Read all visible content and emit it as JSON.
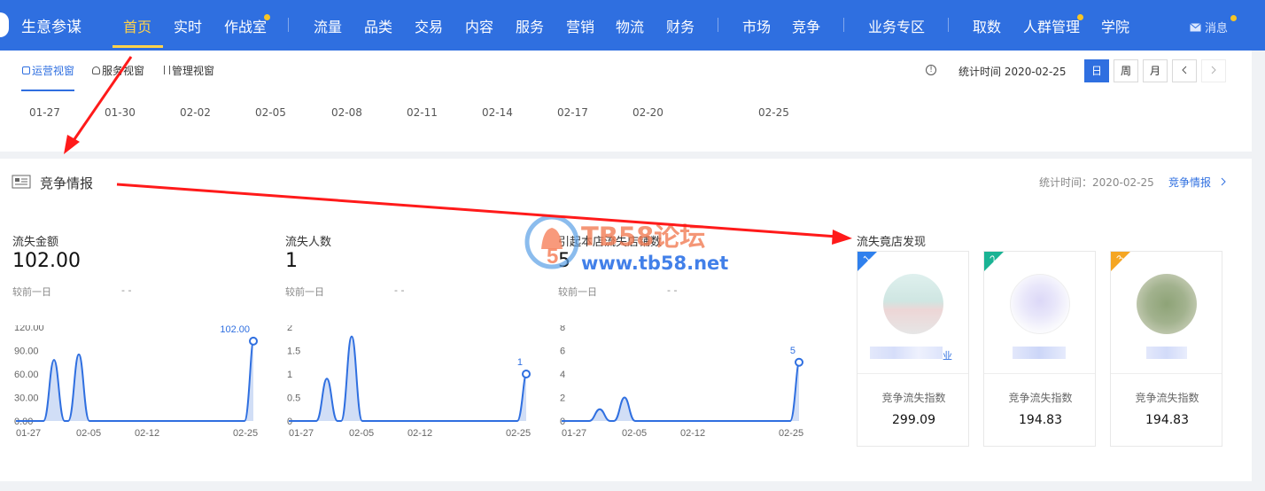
{
  "app": {
    "name": "生意参谋"
  },
  "nav": {
    "items": [
      "首页",
      "实时",
      "作战室",
      "流量",
      "品类",
      "交易",
      "内容",
      "服务",
      "营销",
      "物流",
      "财务",
      "市场",
      "竞争",
      "业务专区",
      "取数",
      "人群管理",
      "学院"
    ],
    "active": "首页",
    "message": "消息"
  },
  "subnav": {
    "tabs": [
      "运营视窗",
      "服务视窗",
      "管理视窗"
    ],
    "stat_label": "统计时间 2020-02-25",
    "periods": [
      "日",
      "周",
      "月"
    ],
    "prev_icon": "chevron-left-icon",
    "next_icon": "chevron-right-icon"
  },
  "date_axis": [
    "01-27",
    "01-30",
    "02-02",
    "02-05",
    "02-08",
    "02-11",
    "02-14",
    "02-17",
    "02-20",
    "02-25"
  ],
  "section": {
    "title": "竞争情报",
    "stat_time": "统计时间：2020-02-25",
    "more_link": "竞争情报",
    "more_icon": "chevron-right-icon"
  },
  "metrics": [
    {
      "label": "流失金额",
      "value": "102.00",
      "compare_label": "较前一日",
      "compare_value": "- -",
      "yticks": [
        "120.00",
        "90.00",
        "60.00",
        "30.00",
        "0.00"
      ],
      "xticks": [
        "01-27",
        "02-05",
        "02-12",
        "02-25"
      ],
      "end_label": "102.00",
      "ymax": 120,
      "end_value": 102
    },
    {
      "label": "流失人数",
      "value": "1",
      "compare_label": "较前一日",
      "compare_value": "- -",
      "yticks": [
        "2",
        "1.5",
        "1",
        "0.5",
        "0"
      ],
      "xticks": [
        "01-27",
        "02-05",
        "02-12",
        "02-25"
      ],
      "end_label": "1",
      "ymax": 2,
      "end_value": 1
    },
    {
      "label": "引起本店流失店铺数",
      "value": "5",
      "compare_label": "较前一日",
      "compare_value": "- -",
      "yticks": [
        "8",
        "6",
        "4",
        "2",
        "0"
      ],
      "xticks": [
        "01-27",
        "02-05",
        "02-12",
        "02-25"
      ],
      "end_label": "5",
      "ymax": 8,
      "end_value": 5
    }
  ],
  "sparkPeaks": [
    {
      "p1": 78,
      "p2": 85
    },
    {
      "p1": 0.9,
      "p2": 1.8
    },
    {
      "p1": 1,
      "p2": 2
    }
  ],
  "competitors": {
    "title": "流失竟店发现",
    "items": [
      {
        "rank": "1",
        "name_tail": "业",
        "index_label": "竞争流失指数",
        "index_value": "299.09",
        "ribbon_color": "#2f80ed"
      },
      {
        "rank": "2",
        "name_tail": "",
        "index_label": "竞争流失指数",
        "index_value": "194.83",
        "ribbon_color": "#1ab394"
      },
      {
        "rank": "3",
        "name_tail": "",
        "index_label": "竞争流失指数",
        "index_value": "194.83",
        "ribbon_color": "#f5a623"
      }
    ]
  },
  "watermark": {
    "text": "TB58论坛",
    "url": "www.tb58.net",
    "logo_digit": "5"
  },
  "colors": {
    "brand": "#2f6fe0",
    "accent": "#ffd24a",
    "annotation_arrow": "#ff1a1a",
    "line": "#2f6fe0",
    "area": "#c9d8f5"
  }
}
